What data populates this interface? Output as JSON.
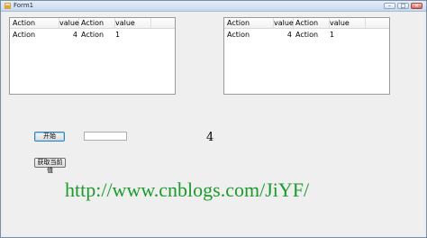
{
  "window": {
    "title": "Form1"
  },
  "titlebar_buttons": {
    "minimize": "–",
    "maximize": "□",
    "close": "×"
  },
  "listviews": [
    {
      "columns": [
        "Action",
        "value",
        "Action",
        "value"
      ],
      "rows": [
        [
          "Action",
          "4",
          "Action",
          "1"
        ]
      ]
    },
    {
      "columns": [
        "Action",
        "value",
        "Action",
        "value"
      ],
      "rows": [
        [
          "Action",
          "4",
          "Action",
          "1"
        ]
      ]
    }
  ],
  "start_button": {
    "label": "开始"
  },
  "get_value_button": {
    "label": "获取当前值"
  },
  "textbox": {
    "value": ""
  },
  "number_display": "4",
  "watermark": "http://www.cnblogs.com/JiYF/"
}
